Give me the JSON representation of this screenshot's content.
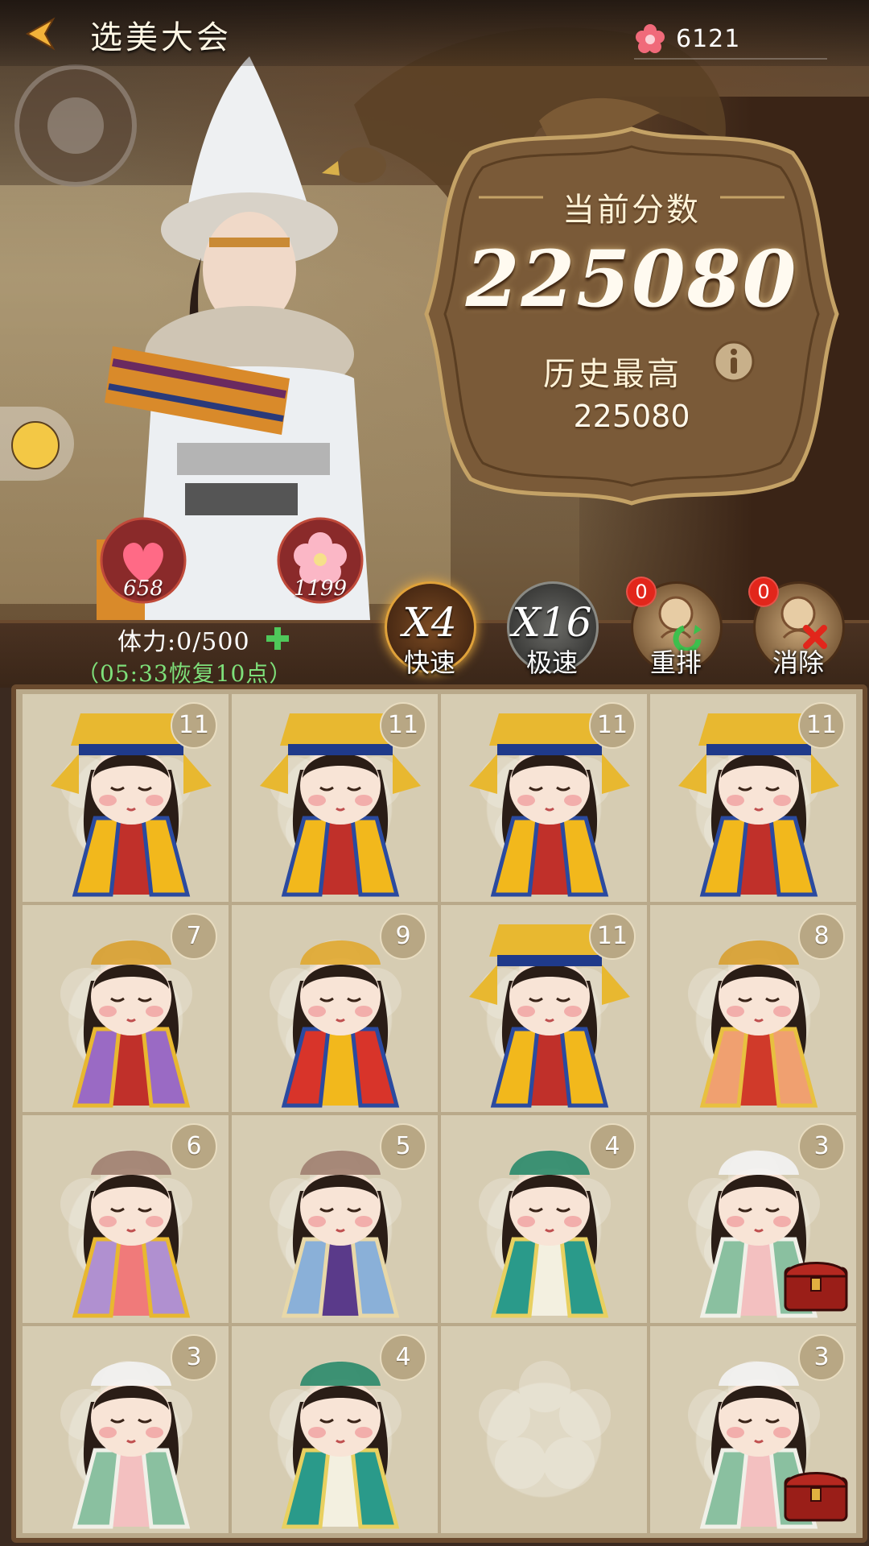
{
  "header": {
    "title": "选美大会",
    "currency_amount": "6121"
  },
  "score": {
    "current_label": "当前分数",
    "current_value": "225080",
    "best_label": "历史最高",
    "best_value": "225080"
  },
  "stats": {
    "hearts": "658",
    "flowers": "1199"
  },
  "stamina": {
    "text": "体力:0/500",
    "recovery": "（05:33恢复10点）"
  },
  "controls": [
    {
      "big": "X4",
      "label": "快速",
      "active": true
    },
    {
      "big": "X16",
      "label": "极速",
      "active": false
    },
    {
      "label": "重排",
      "count": "0"
    },
    {
      "label": "消除",
      "count": "0"
    }
  ],
  "grid": [
    {
      "level": "11",
      "doll": "empress",
      "chest": false
    },
    {
      "level": "11",
      "doll": "empress",
      "chest": false
    },
    {
      "level": "11",
      "doll": "empress",
      "chest": false
    },
    {
      "level": "11",
      "doll": "empress",
      "chest": false
    },
    {
      "level": "7",
      "doll": "purple-lady",
      "chest": false
    },
    {
      "level": "9",
      "doll": "red-queen",
      "chest": false
    },
    {
      "level": "11",
      "doll": "empress",
      "chest": false
    },
    {
      "level": "8",
      "doll": "orange-lady",
      "chest": false
    },
    {
      "level": "6",
      "doll": "lilac-lady",
      "chest": false
    },
    {
      "level": "5",
      "doll": "blue-maid",
      "chest": false
    },
    {
      "level": "4",
      "doll": "teal-maid",
      "chest": false
    },
    {
      "level": "3",
      "doll": "green-maid",
      "chest": true
    },
    {
      "level": "3",
      "doll": "green-maid",
      "chest": false
    },
    {
      "level": "4",
      "doll": "teal-maid",
      "chest": false
    },
    {
      "level": "",
      "doll": "",
      "chest": false
    },
    {
      "level": "3",
      "doll": "green-maid",
      "chest": true
    }
  ],
  "colors": {
    "accent_gold": "#d99a2a",
    "recovery_green": "#7ee07a",
    "badge_red": "#e2261b"
  }
}
